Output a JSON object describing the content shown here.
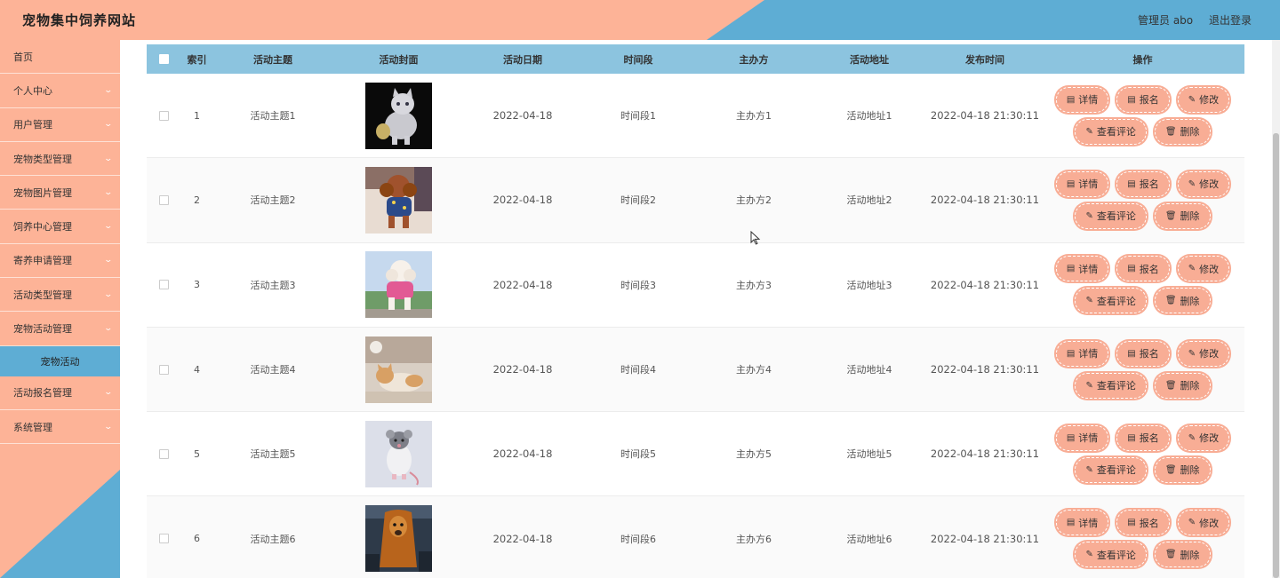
{
  "header": {
    "title": "宠物集中饲养网站",
    "admin": "管理员 abo",
    "logout": "退出登录"
  },
  "colors": {
    "peach": "#fdb397",
    "blue": "#5eadd4",
    "table_head": "#8cc4df",
    "button": "#f8ad95"
  },
  "sidebar": {
    "items": [
      {
        "label": "首页",
        "chevron": false
      },
      {
        "label": "个人中心",
        "chevron": true
      },
      {
        "label": "用户管理",
        "chevron": true
      },
      {
        "label": "宠物类型管理",
        "chevron": true
      },
      {
        "label": "宠物图片管理",
        "chevron": true
      },
      {
        "label": "饲养中心管理",
        "chevron": true
      },
      {
        "label": "寄养申请管理",
        "chevron": true
      },
      {
        "label": "活动类型管理",
        "chevron": true
      },
      {
        "label": "宠物活动管理",
        "chevron": true
      },
      {
        "label": "宠物活动",
        "chevron": false,
        "sub": true
      },
      {
        "label": "活动报名管理",
        "chevron": true
      },
      {
        "label": "系统管理",
        "chevron": true
      }
    ],
    "chevron_icon": "chevron-down-icon"
  },
  "table": {
    "headers": {
      "index": "索引",
      "theme": "活动主题",
      "cover": "活动封面",
      "date": "活动日期",
      "slot": "时间段",
      "organizer": "主办方",
      "address": "活动地址",
      "published": "发布时间",
      "ops": "操作"
    },
    "buttons": {
      "detail": "详情",
      "signup": "报名",
      "edit": "修改",
      "comments": "查看评论",
      "delete": "删除"
    },
    "rows": [
      {
        "index": "1",
        "theme": "活动主题1",
        "cover": "white-kitten-photo",
        "date": "2022-04-18",
        "slot": "时间段1",
        "organizer": "主办方1",
        "address": "活动地址1",
        "published": "2022-04-18 21:30:11"
      },
      {
        "index": "2",
        "theme": "活动主题2",
        "cover": "brown-poodle-photo",
        "date": "2022-04-18",
        "slot": "时间段2",
        "organizer": "主办方2",
        "address": "活动地址2",
        "published": "2022-04-18 21:30:11"
      },
      {
        "index": "3",
        "theme": "活动主题3",
        "cover": "white-poodle-pink-coat-photo",
        "date": "2022-04-18",
        "slot": "时间段3",
        "organizer": "主办方3",
        "address": "活动地址3",
        "published": "2022-04-18 21:30:11"
      },
      {
        "index": "4",
        "theme": "活动主题4",
        "cover": "lying-cat-photo",
        "date": "2022-04-18",
        "slot": "时间段4",
        "organizer": "主办方4",
        "address": "活动地址4",
        "published": "2022-04-18 21:30:11"
      },
      {
        "index": "5",
        "theme": "活动主题5",
        "cover": "grey-rat-photo",
        "date": "2022-04-18",
        "slot": "时间段5",
        "organizer": "主办方5",
        "address": "活动地址5",
        "published": "2022-04-18 21:30:11"
      },
      {
        "index": "6",
        "theme": "活动主题6",
        "cover": "orange-long-hair-dog-photo",
        "date": "2022-04-18",
        "slot": "时间段6",
        "organizer": "主办方6",
        "address": "活动地址6",
        "published": "2022-04-18 21:30:11"
      }
    ]
  }
}
